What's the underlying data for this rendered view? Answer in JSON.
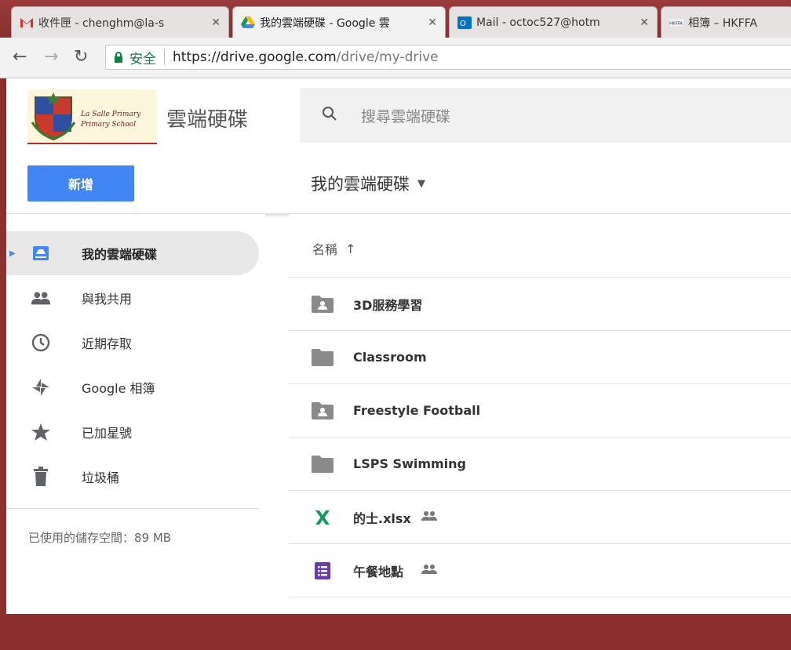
{
  "browser": {
    "tabs": [
      {
        "icon": "gmail-icon",
        "title": "收件匣 - chenghm@la-s"
      },
      {
        "icon": "google-drive-icon",
        "title": "我的雲端硬碟 - Google 雲"
      },
      {
        "icon": "outlook-icon",
        "title": "Mail - octoc527@hotm"
      },
      {
        "icon": "hkffa-icon",
        "title": "相簿 – HKFFA"
      }
    ],
    "secure_label": "安全",
    "url_host": "https://drive.google.com",
    "url_path": "/drive/my-drive"
  },
  "drive": {
    "logo_line1": "La Salle Primary",
    "logo_line2": "Primary School",
    "app_title": "雲端硬碟",
    "search_placeholder": "搜尋雲端硬碟",
    "new_button": "新增",
    "current_folder": "我的雲端硬碟",
    "nav": [
      {
        "label": "我的雲端硬碟",
        "icon": "my-drive-icon"
      },
      {
        "label": "與我共用",
        "icon": "people-icon"
      },
      {
        "label": "近期存取",
        "icon": "clock-icon"
      },
      {
        "label": "Google 相簿",
        "icon": "pinwheel-icon"
      },
      {
        "label": "已加星號",
        "icon": "star-icon"
      },
      {
        "label": "垃圾桶",
        "icon": "trash-icon"
      }
    ],
    "storage_text": "已使用的儲存空間：89 MB",
    "column_name": "名稱",
    "files": [
      {
        "name": "3D服務學習",
        "type": "shared-folder"
      },
      {
        "name": "Classroom",
        "type": "folder"
      },
      {
        "name": "Freestyle Football",
        "type": "shared-folder"
      },
      {
        "name": "LSPS Swimming",
        "type": "folder"
      },
      {
        "name": "的士.xlsx",
        "type": "sheet",
        "shared": true
      },
      {
        "name": "午餐地點",
        "type": "form",
        "shared": true
      }
    ]
  },
  "colors": {
    "accent": "#4285f4",
    "sheet_green": "#0f9d58",
    "form_purple": "#673ab7",
    "folder_grey": "#8a8a8a"
  }
}
